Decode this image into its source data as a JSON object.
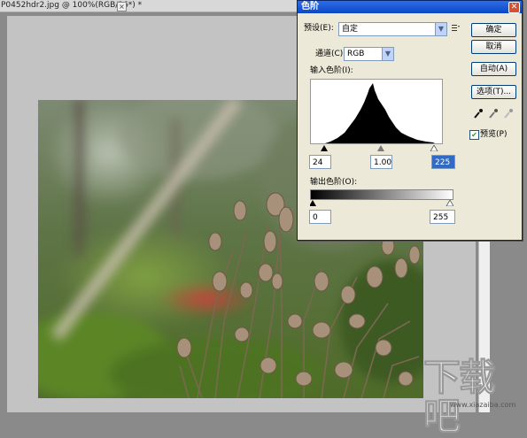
{
  "document": {
    "tab_title": "P0452hdr2.jpg @ 100%(RGB/16*) *",
    "close_glyph": "×"
  },
  "dialog": {
    "title": "色阶",
    "close_glyph": "✕",
    "preset_label": "预设(E):",
    "preset_value": "自定",
    "channel_label": "通道(C):",
    "channel_value": "RGB",
    "input_levels_label": "输入色阶(I):",
    "input_black": "24",
    "input_gamma": "1.00",
    "input_white": "225",
    "output_levels_label": "输出色阶(O):",
    "output_black": "0",
    "output_white": "255",
    "buttons": {
      "ok": "确定",
      "cancel": "取消",
      "auto": "自动(A)",
      "options": "选项(T)..."
    },
    "preview_label": "预览(P)",
    "preview_checked": true
  },
  "watermark": {
    "logo_text": "下载吧",
    "url": "www.xiazaiba.com"
  },
  "colors": {
    "selection_highlight": "#316ac5",
    "titlebar": "#0b47c4",
    "dialog_bg": "#ece9d8"
  }
}
